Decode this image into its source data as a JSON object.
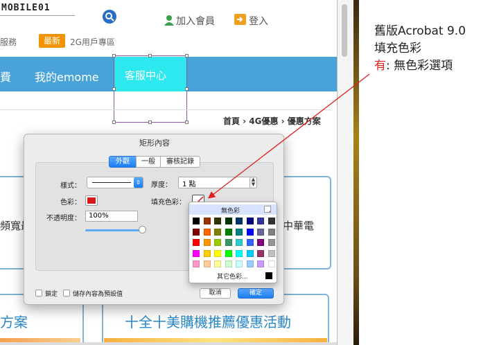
{
  "site": {
    "logo": "MOBILE01",
    "header": {
      "member": "加入會員",
      "login": "登入"
    },
    "subbar": {
      "services": "服務",
      "latest_badge": "最新",
      "g2_link": "2G用戶專區"
    },
    "nav": {
      "fee": "費",
      "myemome": "我的emome",
      "service": "客服中心"
    },
    "breadcrumb": "首頁 › 4G優惠 › 優惠方案",
    "panels": {
      "left_text": "頻寬最",
      "right_text": "中華電"
    },
    "boxes": {
      "left_title": "方案",
      "right_title": "十全十美購機推薦優惠活動"
    }
  },
  "dialog": {
    "title": "矩形內容",
    "tabs": [
      "外觀",
      "一般",
      "審核記錄"
    ],
    "active_tab": "外觀",
    "style_label": "樣式：",
    "thickness_label": "厚度：",
    "thickness_value": "1 點",
    "color_label": "色彩：",
    "fill_label": "填充色彩：",
    "opacity_label": "不透明度：",
    "opacity_value": "100%",
    "opacity_level": 1.0,
    "locked_label": "鎖定",
    "save_default_label": "儲存內容為預設值",
    "cancel": "取消",
    "ok": "確定",
    "stroke_color": "#d81818"
  },
  "palette": {
    "no_color": "無色彩",
    "other_colors": "其它色彩...",
    "rows": [
      [
        "#000000",
        "#993300",
        "#333300",
        "#003300",
        "#003366",
        "#000080",
        "#333399",
        "#333333"
      ],
      [
        "#800000",
        "#ff6600",
        "#808000",
        "#008000",
        "#008080",
        "#0000ff",
        "#666699",
        "#808080"
      ],
      [
        "#ff0000",
        "#ff9900",
        "#99cc00",
        "#339966",
        "#33cccc",
        "#3366ff",
        "#800080",
        "#969696"
      ],
      [
        "#ff00ff",
        "#ffcc00",
        "#ffff00",
        "#00ff00",
        "#00ffff",
        "#00ccff",
        "#993366",
        "#c0c0c0"
      ],
      [
        "#ff99cc",
        "#ffcc99",
        "#ffff99",
        "#ccffcc",
        "#ccffff",
        "#99ccff",
        "#cc99ff",
        "#ffffff"
      ]
    ]
  },
  "annotation": {
    "line1": "舊版Acrobat 9.0",
    "line2": "填充色彩",
    "line3_red": "有",
    "line3_rest": ": 無色彩選項"
  }
}
